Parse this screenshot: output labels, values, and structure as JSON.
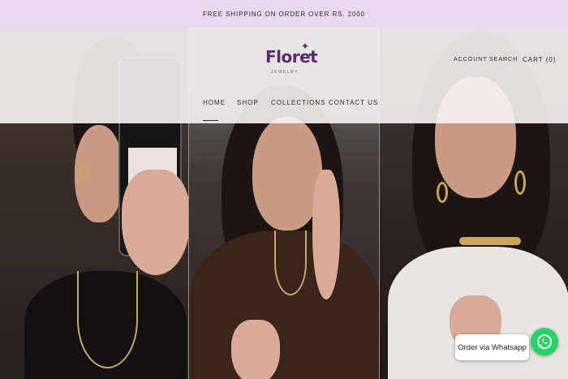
{
  "announcement": "FREE SHIPPING ON ORDER OVER RS. 2000",
  "brand": {
    "name": "Floret",
    "tagline": "JEWELRY",
    "color": "#5b2b66"
  },
  "nav": {
    "items": [
      {
        "label": "HOME",
        "active": true
      },
      {
        "label": "SHOP",
        "active": false
      },
      {
        "label": "COLLECTIONS",
        "active": false
      },
      {
        "label": "CONTACT US",
        "active": false
      }
    ]
  },
  "utility": {
    "account": "ACCOUNT",
    "search": "SEARCH",
    "cart": "CART (0)"
  },
  "whatsapp": {
    "label": "Order via Whatsapp",
    "color": "#25d366",
    "icon": "whatsapp-icon"
  },
  "colors": {
    "announcement_bg": "#ead9ee",
    "nav_overlay": "#f6f3f4"
  }
}
